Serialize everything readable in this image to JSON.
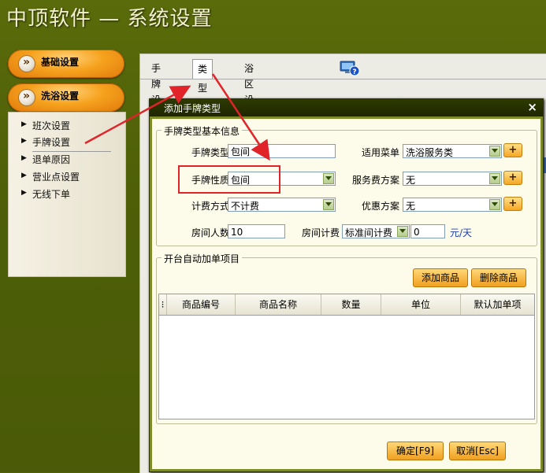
{
  "app": {
    "title": "中顶软件 — 系统设置"
  },
  "sidebar": {
    "nav": [
      {
        "label": "基础设置"
      },
      {
        "label": "洗浴设置"
      }
    ],
    "items": [
      {
        "label": "班次设置"
      },
      {
        "label": "手牌设置"
      },
      {
        "label": "退单原因"
      },
      {
        "label": "营业点设置"
      },
      {
        "label": "无线下单"
      }
    ]
  },
  "tabs": [
    {
      "label": "手牌设置"
    },
    {
      "label": "类型设置"
    },
    {
      "label": "浴区设置"
    }
  ],
  "dialog": {
    "title": "添加手牌类型",
    "basic_group": "手牌类型基本信息",
    "fields": {
      "card_type_label": "手牌类型",
      "card_type_value": "包间",
      "menu_label": "适用菜单",
      "menu_value": "洗浴服务类",
      "nature_label": "手牌性质",
      "nature_value": "包间",
      "service_fee_label": "服务费方案",
      "service_fee_value": "无",
      "billing_label": "计费方式",
      "billing_value": "不计费",
      "discount_label": "优惠方案",
      "discount_value": "无",
      "room_people_label": "房间人数",
      "room_people_value": "10",
      "room_fee_label": "房间计费",
      "room_fee_select": "标准间计费",
      "room_fee_value": "0",
      "room_fee_unit": "元/天"
    },
    "plus_label": "+",
    "auto_group": "开台自动加单项目",
    "add_goods": "添加商品",
    "delete_goods": "删除商品",
    "grid_columns": [
      "商品编号",
      "商品名称",
      "数量",
      "单位",
      "默认加单项"
    ],
    "ok_button": "确定[F9]",
    "cancel_button": "取消[Esc]",
    "close_glyph": "×"
  },
  "colors": {
    "accent_orange": "#f6a21e",
    "dialog_frame": "#7d8c27",
    "annotation_red": "#e0242a"
  }
}
